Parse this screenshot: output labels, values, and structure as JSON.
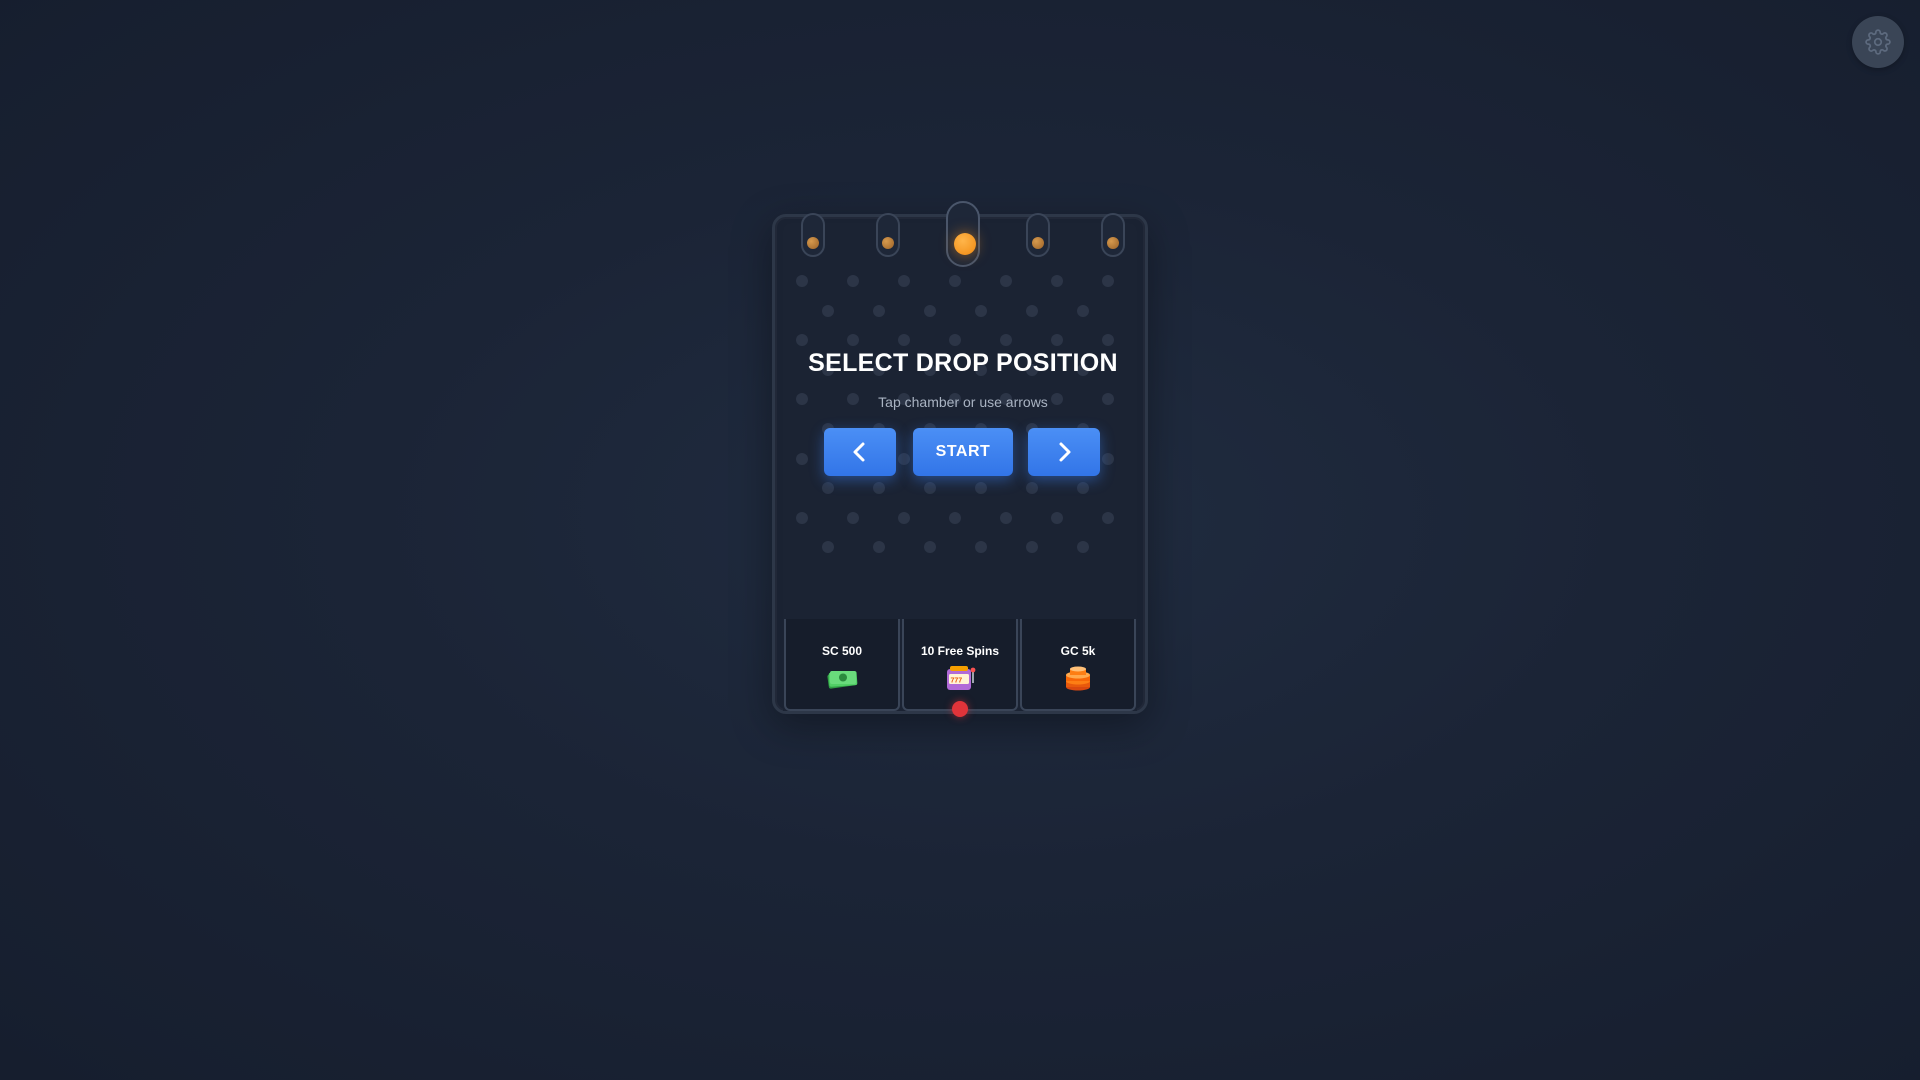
{
  "settings": {
    "icon": "gear-icon"
  },
  "board": {
    "chambers": [
      {
        "name": "chamber-1",
        "active": false
      },
      {
        "name": "chamber-2",
        "active": false
      },
      {
        "name": "chamber-3",
        "active": true
      },
      {
        "name": "chamber-4",
        "active": false
      },
      {
        "name": "chamber-5",
        "active": false
      }
    ],
    "selected_chamber": 3,
    "title": "SELECT DROP POSITION",
    "subtitle": "Tap chamber or use arrows",
    "controls": {
      "prev_icon": "chevron-left-icon",
      "start_label": "START",
      "next_icon": "chevron-right-icon"
    },
    "prizes": [
      {
        "label": "SC 500",
        "icon": "cash-icon"
      },
      {
        "label": "10 Free Spins",
        "icon": "slot-machine-icon",
        "marked": true
      },
      {
        "label": "GC 5k",
        "icon": "coins-icon"
      }
    ]
  },
  "colors": {
    "accent": "#3b82f6",
    "ball": "#f59e0b",
    "marker": "#e0343a",
    "background": "#1b2436"
  }
}
